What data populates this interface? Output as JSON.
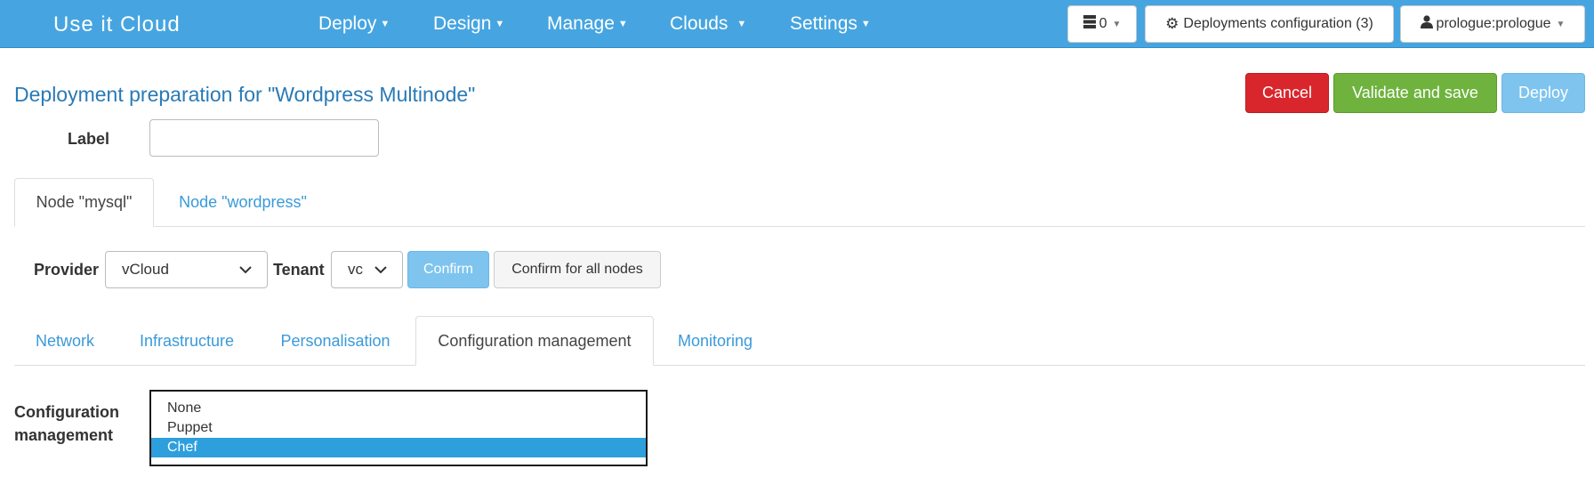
{
  "app": {
    "brand": "Use it Cloud"
  },
  "nav": {
    "menus": [
      {
        "label": "Deploy"
      },
      {
        "label": "Design"
      },
      {
        "label": "Manage"
      },
      {
        "label": "Clouds"
      },
      {
        "label": "Settings"
      }
    ],
    "counter_value": "0",
    "deployments_config_label": "Deployments configuration (3)",
    "user_label": "prologue:prologue"
  },
  "page": {
    "title": "Deployment preparation for \"Wordpress Multinode\"",
    "cancel_label": "Cancel",
    "validate_label": "Validate and save",
    "deploy_label": "Deploy",
    "label_field": {
      "label": "Label",
      "value": "",
      "placeholder": ""
    }
  },
  "node_tabs": [
    {
      "label": "Node \"mysql\"",
      "active": true
    },
    {
      "label": "Node \"wordpress\"",
      "active": false
    }
  ],
  "provider": {
    "provider_label": "Provider",
    "provider_value": "vCloud",
    "tenant_label": "Tenant",
    "tenant_value": "vc",
    "confirm_label": "Confirm",
    "confirm_all_label": "Confirm for all nodes"
  },
  "section_tabs": [
    {
      "label": "Network",
      "active": false
    },
    {
      "label": "Infrastructure",
      "active": false
    },
    {
      "label": "Personalisation",
      "active": false
    },
    {
      "label": "Configuration management",
      "active": true
    },
    {
      "label": "Monitoring",
      "active": false
    }
  ],
  "config_mgmt": {
    "label_line1": "Configuration",
    "label_line2": "management",
    "options": [
      "None",
      "Puppet",
      "Chef"
    ],
    "selected": "Chef"
  },
  "colors": {
    "navbar": "#46a5e0",
    "cancel": "#d9262c",
    "validate": "#6fb33e",
    "deploy": "#7ec4ee",
    "link": "#3a9ad9",
    "selected_option": "#2e9fdd"
  },
  "icons": {
    "counter": "server-stack-icon",
    "deployments_config": "gear-icon",
    "user": "user-icon",
    "dropdown": "chevron-down-icon"
  }
}
